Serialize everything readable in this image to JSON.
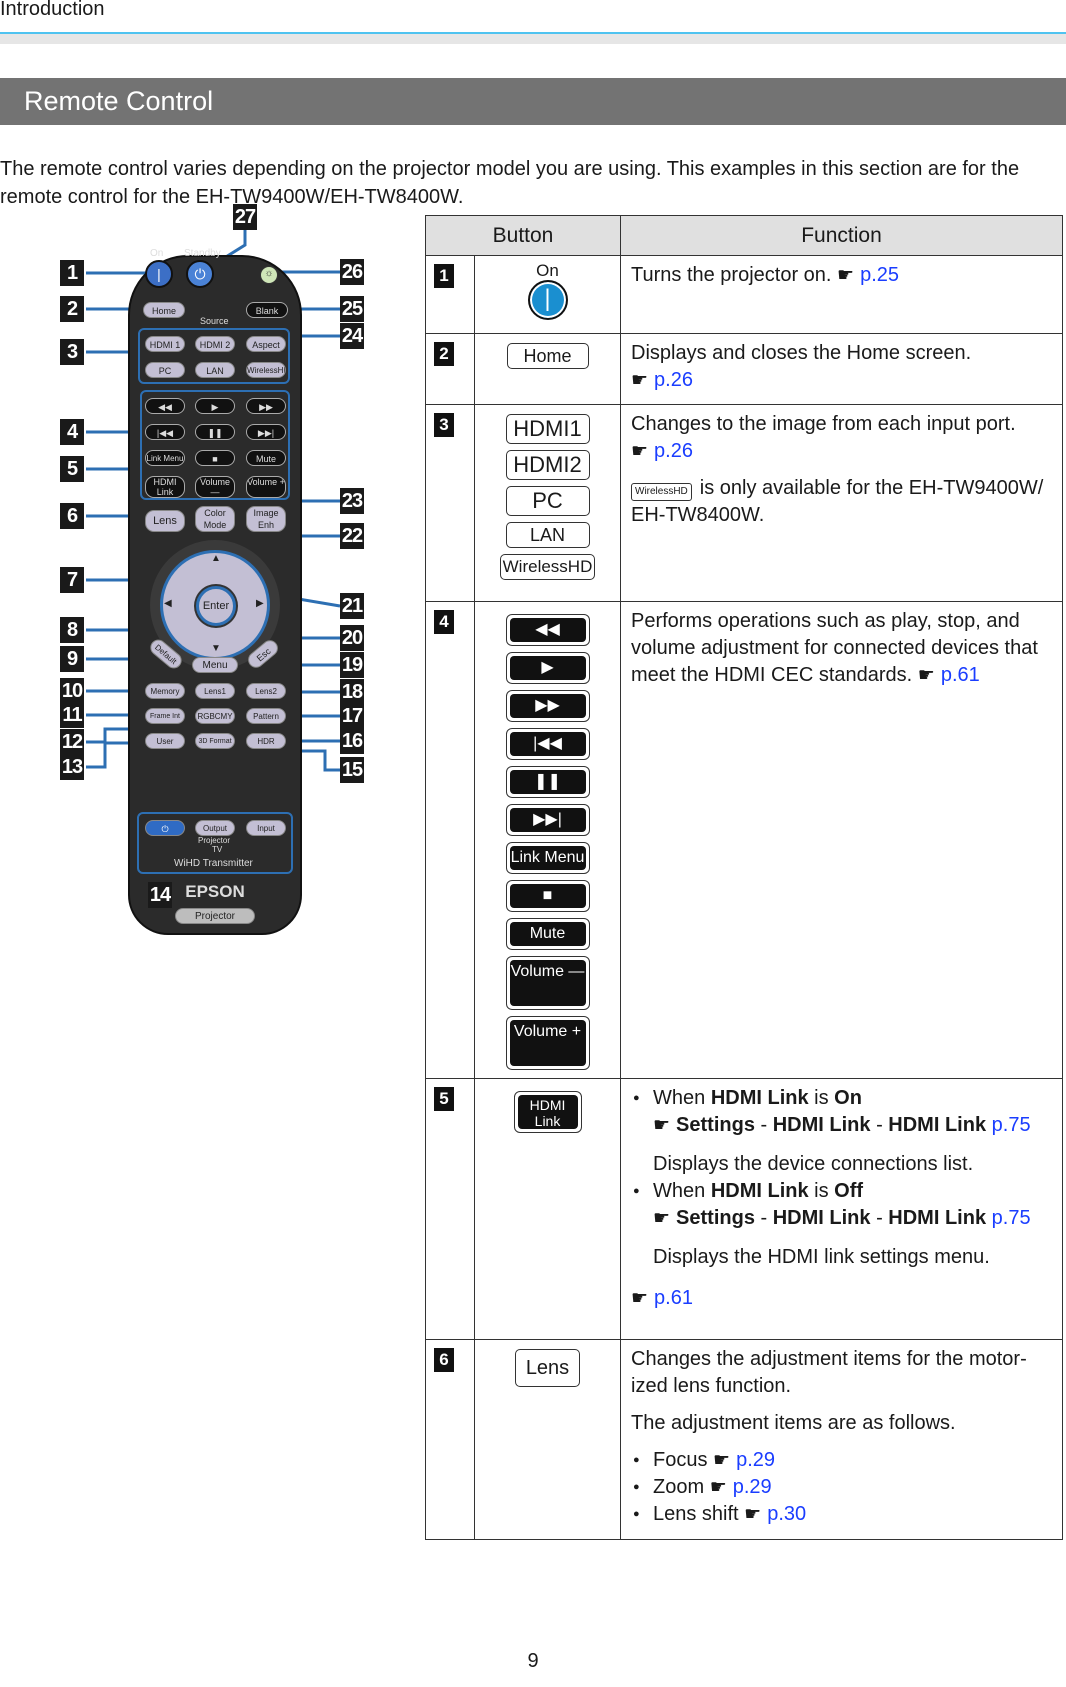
{
  "header": {
    "section": "Introduction"
  },
  "section_title": "Remote Control",
  "intro": "The remote control varies depending on the projector model you are using. This examples in this section are for the remote control for the EH-TW9400W/EH-TW8400W.",
  "remote": {
    "labels": {
      "on": "On",
      "standby": "Standby",
      "source": "Source",
      "wihd": "WiHD Transmitter",
      "projector_tv_top": "Projector",
      "projector_tv_bottom": "TV",
      "brand": "EPSON",
      "model": "Projector"
    },
    "buttons": {
      "home": "Home",
      "blank": "Blank",
      "hdmi1": "HDMI 1",
      "hdmi2": "HDMI 2",
      "aspect": "Aspect",
      "pc": "PC",
      "lan": "LAN",
      "wireless_hd": "WirelessHD",
      "rewind": "◀◀",
      "play": "▶",
      "ff": "▶▶",
      "prev": "|◀◀",
      "pause": "❚❚",
      "next": "▶▶|",
      "link_menu": "Link Menu",
      "stop": "■",
      "mute": "Mute",
      "hdmi_link": "HDMI Link",
      "vol_down": "Volume —",
      "vol_up": "Volume +",
      "lens": "Lens",
      "color_mode": "Color Mode",
      "image_enh": "Image Enh",
      "enter": "Enter",
      "default": "Default",
      "menu": "Menu",
      "esc": "Esc",
      "memory": "Memory",
      "lens1": "Lens1",
      "lens2": "Lens2",
      "frame_int": "Frame Int",
      "rgbcmy": "RGBCMY",
      "pattern": "Pattern",
      "user": "User",
      "format_3d": "3D Format",
      "hdr": "HDR",
      "output": "Output",
      "input": "Input"
    },
    "callouts_left": [
      "1",
      "2",
      "3",
      "4",
      "5",
      "6",
      "7",
      "8",
      "9",
      "10",
      "11",
      "12",
      "13"
    ],
    "callouts_right": [
      "27",
      "26",
      "25",
      "24",
      "23",
      "22",
      "21",
      "20",
      "19",
      "18",
      "17",
      "16",
      "15"
    ],
    "callout_bottom": "14"
  },
  "table": {
    "headers": {
      "button": "Button",
      "function": "Function"
    },
    "rows": [
      {
        "num": "1",
        "buttons": [
          "On"
        ],
        "text": "Turns the projector on.",
        "ref": "p.25"
      },
      {
        "num": "2",
        "buttons": [
          "Home"
        ],
        "text": "Displays and closes the Home screen.",
        "ref": "p.26"
      },
      {
        "num": "3",
        "buttons": [
          "HDMI1",
          "HDMI2",
          "PC",
          "LAN",
          "WirelessHD"
        ],
        "text": "Changes to the image from each input port.",
        "ref": "p.26",
        "note_btn": "WirelessHD",
        "note": "is only available for the EH-TW9400W/ EH-TW8400W."
      },
      {
        "num": "4",
        "buttons": [
          "◀◀",
          "▶",
          "▶▶",
          "|◀◀",
          "❚❚",
          "▶▶|",
          "Link Menu",
          "■",
          "Mute",
          "Volume —",
          "Volume +"
        ],
        "text": "Performs operations such as play, stop, and volume adjustment for connected devices that meet the HDMI CEC standards.",
        "ref": "p.61"
      },
      {
        "num": "5",
        "buttons": [
          "HDMI Link"
        ],
        "bullet1": {
          "when": "When",
          "k1": "HDMI Link",
          "is": "is",
          "v": "On",
          "path1": "Settings",
          "path2": "HDMI Link",
          "path3": "HDMI Link",
          "ref": "p.75",
          "desc": "Displays the device connections list."
        },
        "bullet2": {
          "when": "When",
          "k1": "HDMI Link",
          "is": "is",
          "v": "Off",
          "path1": "Settings",
          "path2": "HDMI Link",
          "path3": "HDMI Link",
          "ref": "p.75",
          "desc": "Displays the HDMI link settings menu."
        },
        "ref": "p.61"
      },
      {
        "num": "6",
        "buttons": [
          "Lens"
        ],
        "text": "Changes the adjustment items for the motor-ized lens function.",
        "text2": "The adjustment items are as follows.",
        "items": [
          {
            "label": "Focus",
            "ref": "p.29"
          },
          {
            "label": "Zoom",
            "ref": "p.29"
          },
          {
            "label": "Lens shift",
            "ref": "p.30"
          }
        ]
      }
    ]
  },
  "pointer_icon": "☛",
  "page_number": "9",
  "colors": {
    "accent_rule": "#4fc3f0",
    "section_bar": "#737373",
    "link": "#1a3dff",
    "callout_line": "#2d6fb3"
  }
}
